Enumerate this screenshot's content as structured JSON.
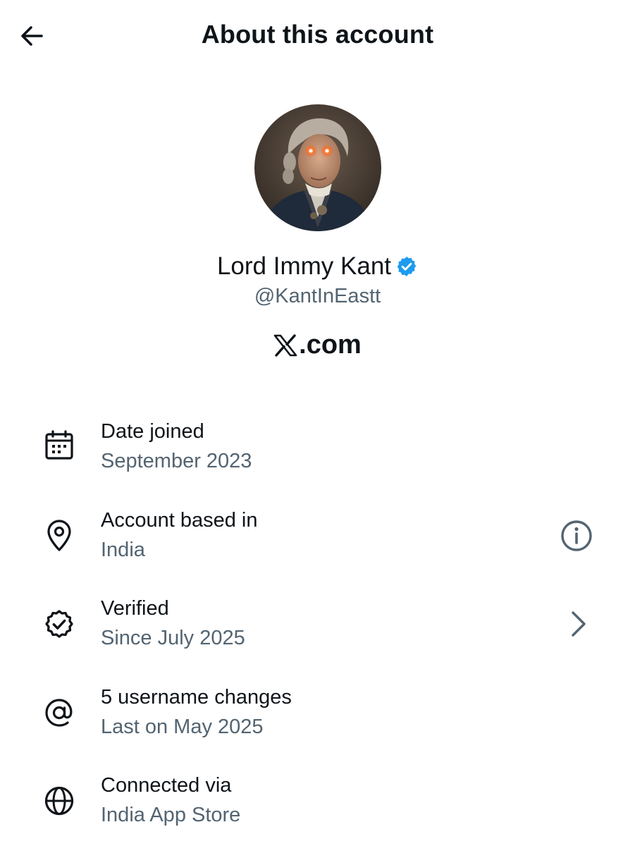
{
  "header": {
    "title": "About this account",
    "back_icon": "arrow-left-icon"
  },
  "profile": {
    "display_name": "Lord Immy Kant",
    "handle": "@KantInEastt",
    "verified_badge_color": "#1d9bf0",
    "site_label": ".com",
    "avatar_description_icon": "avatar"
  },
  "rows": [
    {
      "icon": "calendar-icon",
      "title": "Date joined",
      "subtitle": "September 2023"
    },
    {
      "icon": "location-pin-icon",
      "title": "Account based in",
      "subtitle": "India",
      "action_icon": "info-icon"
    },
    {
      "icon": "verified-badge-icon",
      "title": "Verified",
      "subtitle": "Since July 2025",
      "action_icon": "chevron-right-icon"
    },
    {
      "icon": "at-sign-icon",
      "title": "5 username changes",
      "subtitle": "Last on May 2025"
    },
    {
      "icon": "globe-icon",
      "title": "Connected via",
      "subtitle": "India App Store"
    }
  ],
  "colors": {
    "text_primary": "#0f1419",
    "text_secondary": "#536471",
    "accent": "#1d9bf0",
    "background": "#ffffff"
  }
}
